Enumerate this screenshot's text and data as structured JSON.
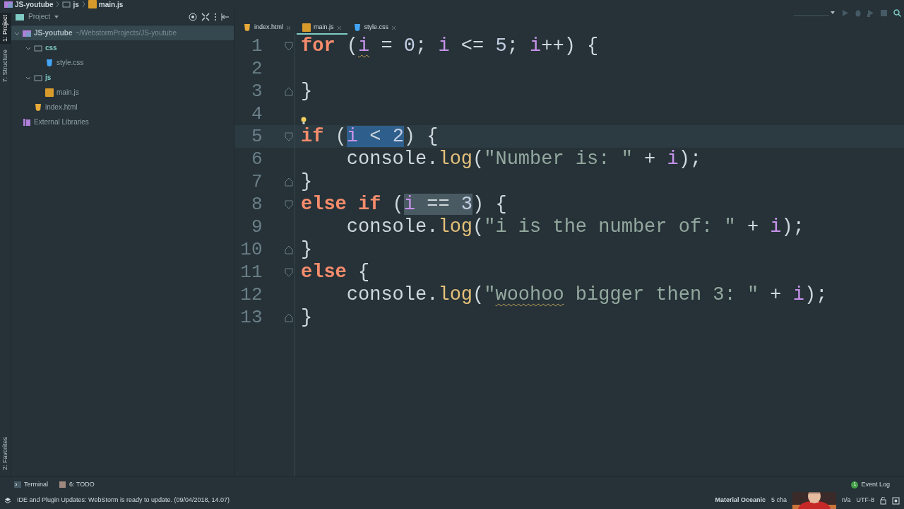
{
  "breadcrumb": [
    {
      "kind": "project",
      "label": "JS-youtube"
    },
    {
      "kind": "folder",
      "label": "js"
    },
    {
      "kind": "js",
      "label": "main.js"
    }
  ],
  "tool_strip": {
    "top": [
      {
        "label": "1: Project",
        "selected": true
      },
      {
        "label": "7: Structure",
        "selected": false
      }
    ],
    "bottom": [
      {
        "label": "2: Favorites",
        "selected": false
      }
    ]
  },
  "project_panel": {
    "title": "Project",
    "tree": [
      {
        "kind": "project",
        "label": "JS-youtube",
        "path": "~/WebstormProjects/JS-youtube",
        "selected": true,
        "expanded": true,
        "children": [
          {
            "kind": "folder",
            "label": "css",
            "selected": false,
            "expanded": true,
            "children": [
              {
                "kind": "css",
                "label": "style.css",
                "selected": false
              }
            ]
          },
          {
            "kind": "folder",
            "label": "js",
            "selected": false,
            "expanded": true,
            "children": [
              {
                "kind": "js",
                "label": "main.js",
                "selected": false
              }
            ]
          },
          {
            "kind": "html",
            "label": "index.html",
            "selected": false
          }
        ]
      },
      {
        "kind": "library",
        "label": "External Libraries",
        "selected": false
      }
    ]
  },
  "tabs": [
    {
      "kind": "html",
      "label": "index.html",
      "selected": false
    },
    {
      "kind": "js",
      "label": "main.js",
      "selected": true
    },
    {
      "kind": "css",
      "label": "style.css",
      "selected": false
    }
  ],
  "editor": {
    "lines": [
      {
        "number": "1",
        "fold_start": true,
        "tokens": [
          {
            "kind": "keyword",
            "text": "for"
          },
          {
            "kind": "plain",
            "text": " ("
          },
          {
            "kind": "var",
            "text": "i",
            "squiggle": true
          },
          {
            "kind": "plain",
            "text": " = "
          },
          {
            "kind": "num",
            "text": "0"
          },
          {
            "kind": "plain",
            "text": "; "
          },
          {
            "kind": "var",
            "text": "i"
          },
          {
            "kind": "plain",
            "text": " <= "
          },
          {
            "kind": "num",
            "text": "5"
          },
          {
            "kind": "plain",
            "text": "; "
          },
          {
            "kind": "var",
            "text": "i"
          },
          {
            "kind": "plain",
            "text": "++) {"
          }
        ]
      },
      {
        "number": "2"
      },
      {
        "number": "3",
        "fold_end": true,
        "tokens": [
          {
            "kind": "plain",
            "text": "}"
          }
        ]
      },
      {
        "number": "4",
        "bulb": true
      },
      {
        "number": "5",
        "fold_start": true,
        "current": true,
        "tokens": [
          {
            "kind": "keyword",
            "text": "if"
          },
          {
            "kind": "plain",
            "text": " ("
          },
          {
            "kind": "var",
            "text": "i",
            "selected": true
          },
          {
            "kind": "plain",
            "text": " < ",
            "selected": true
          },
          {
            "kind": "num",
            "text": "2",
            "selected": true
          },
          {
            "kind": "plain",
            "text": ") {"
          }
        ]
      },
      {
        "number": "6",
        "tokens": [
          {
            "kind": "plain",
            "text": "    console."
          },
          {
            "kind": "func",
            "text": "log"
          },
          {
            "kind": "plain",
            "text": "("
          },
          {
            "kind": "str",
            "text": "\"Number is: \""
          },
          {
            "kind": "plain",
            "text": " + "
          },
          {
            "kind": "var",
            "text": "i"
          },
          {
            "kind": "plain",
            "text": ");"
          }
        ]
      },
      {
        "number": "7",
        "fold_end": true,
        "tokens": [
          {
            "kind": "plain",
            "text": "}"
          }
        ]
      },
      {
        "number": "8",
        "fold_start": true,
        "tokens": [
          {
            "kind": "keyword",
            "text": "else if"
          },
          {
            "kind": "plain",
            "text": " ("
          },
          {
            "kind": "var",
            "text": "i",
            "usage": true
          },
          {
            "kind": "plain",
            "text": " == ",
            "usage": true
          },
          {
            "kind": "num",
            "text": "3",
            "usage": true
          },
          {
            "kind": "plain",
            "text": ") {"
          }
        ]
      },
      {
        "number": "9",
        "tokens": [
          {
            "kind": "plain",
            "text": "    console."
          },
          {
            "kind": "func",
            "text": "log"
          },
          {
            "kind": "plain",
            "text": "("
          },
          {
            "kind": "str",
            "text": "\"i is the number of: \""
          },
          {
            "kind": "plain",
            "text": " + "
          },
          {
            "kind": "var",
            "text": "i"
          },
          {
            "kind": "plain",
            "text": ");"
          }
        ]
      },
      {
        "number": "10",
        "fold_end": true,
        "tokens": [
          {
            "kind": "plain",
            "text": "}"
          }
        ]
      },
      {
        "number": "11",
        "fold_start": true,
        "tokens": [
          {
            "kind": "keyword",
            "text": "else"
          },
          {
            "kind": "plain",
            "text": " {"
          }
        ]
      },
      {
        "number": "12",
        "tokens": [
          {
            "kind": "plain",
            "text": "    console."
          },
          {
            "kind": "func",
            "text": "log"
          },
          {
            "kind": "plain",
            "text": "("
          },
          {
            "kind": "str",
            "text": "\""
          },
          {
            "kind": "str",
            "text": "woohoo",
            "squiggle": true
          },
          {
            "kind": "str",
            "text": " bigger then 3: \""
          },
          {
            "kind": "plain",
            "text": " + "
          },
          {
            "kind": "var",
            "text": "i"
          },
          {
            "kind": "plain",
            "text": ");"
          }
        ]
      },
      {
        "number": "13",
        "fold_end": true,
        "tokens": [
          {
            "kind": "plain",
            "text": "}"
          }
        ]
      }
    ]
  },
  "tool_windows": [
    {
      "kind": "terminal",
      "label": "Terminal"
    },
    {
      "kind": "todo",
      "label": "6: TODO"
    }
  ],
  "event_log": {
    "label": "Event Log",
    "count": "1"
  },
  "status_bar": {
    "message": "IDE and Plugin Updates: WebStorm is ready to update. (09/04/2018, 14.07)",
    "theme": "Material Oceanic",
    "items": [
      "5 cha",
      "n/a",
      "UTF-8"
    ]
  }
}
